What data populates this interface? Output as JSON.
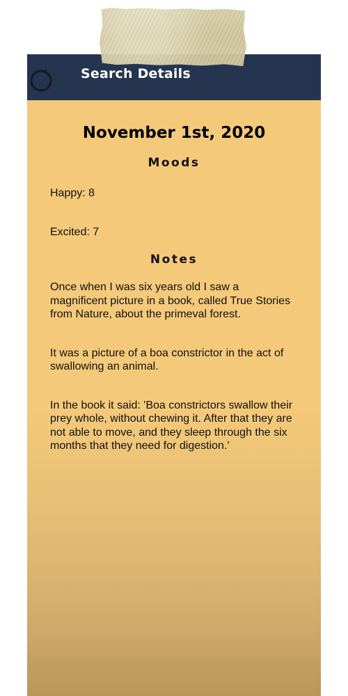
{
  "colors": {
    "header_bg": "#253550",
    "card_top": "#f4c97a",
    "card_bottom": "#b99758",
    "tape": "#d3c99e"
  },
  "header": {
    "back_icon": "back-circle-icon",
    "title": "Search Details"
  },
  "entry": {
    "date": "November 1st, 2020",
    "moods_heading": "Moods",
    "moods": [
      {
        "label": "Happy: 8"
      },
      {
        "label": "Excited: 7"
      }
    ],
    "notes_heading": "Notes",
    "notes": [
      "Once when I was six years old I saw a magnificent picture in a book, called True Stories from Nature, about the primeval forest.",
      "It was a picture of a boa constrictor in the act of swallowing an animal.",
      "In the book it said: 'Boa constrictors swallow their prey whole, without chewing it. After that they are not able to move, and they sleep through the six months that they need for digestion.'"
    ]
  }
}
